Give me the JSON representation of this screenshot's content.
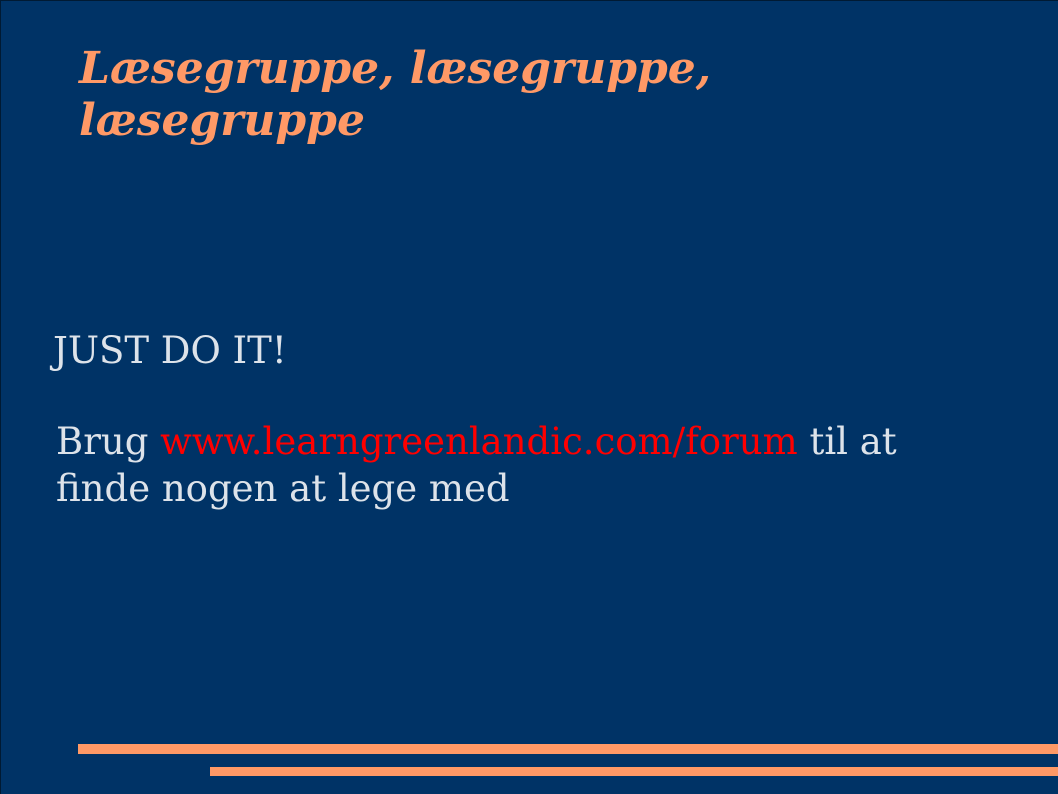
{
  "slide": {
    "title_line1": "Læsegruppe, læsegruppe,",
    "title_line2": "læsegruppe",
    "body": {
      "shout": "JUST DO IT!",
      "pre_link": "Brug ",
      "link_text": "www.learngreenlandic.com/forum",
      "post_link": " til at",
      "line2": "finde nogen at lege med"
    }
  },
  "colors": {
    "background": "#003366",
    "title": "#ff9966",
    "body_text": "#dde3ea",
    "link": "#ff0000",
    "accent_rules": "#ff9966"
  }
}
